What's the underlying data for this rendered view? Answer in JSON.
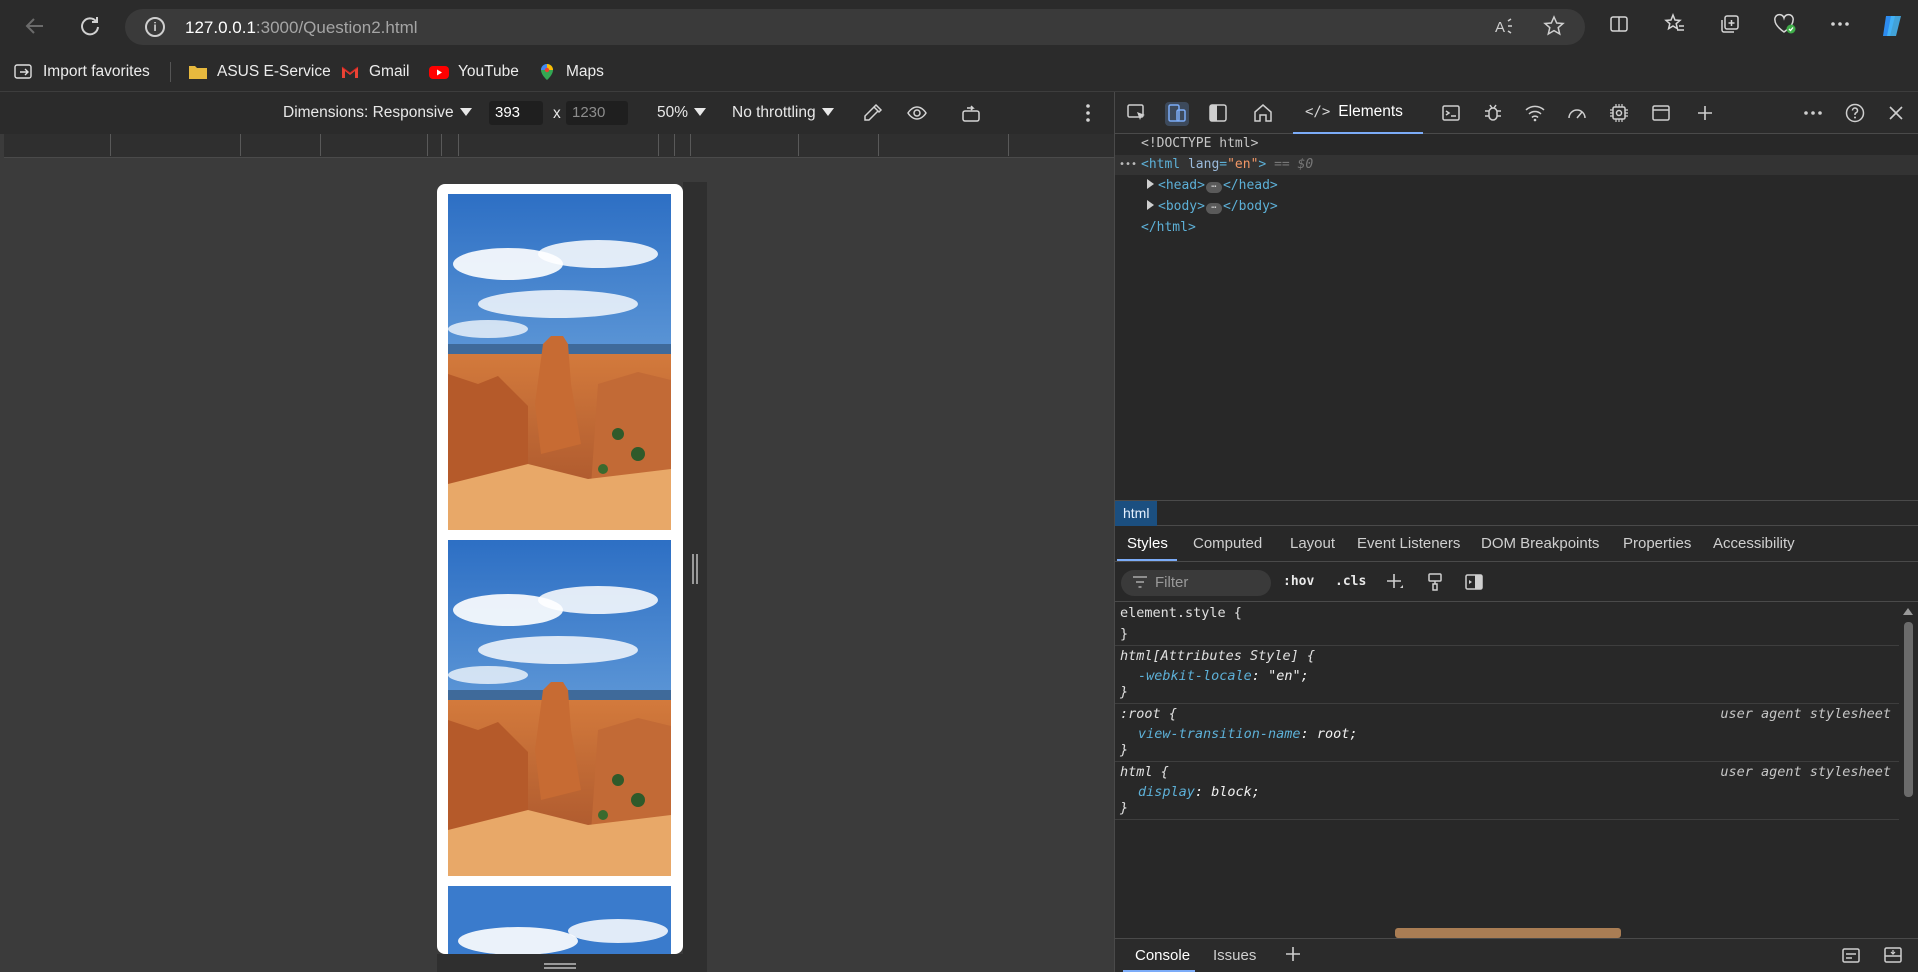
{
  "browser": {
    "url_host": "127.0.0.1",
    "url_path": ":3000/Question2.html",
    "favorites": [
      {
        "label": "Import favorites",
        "icon": "import-icon"
      },
      {
        "label": "ASUS E-Service",
        "icon": "folder-icon"
      },
      {
        "label": "Gmail",
        "icon": "gmail-icon"
      },
      {
        "label": "YouTube",
        "icon": "youtube-icon"
      },
      {
        "label": "Maps",
        "icon": "maps-icon"
      }
    ]
  },
  "device_toolbar": {
    "dimensions_label": "Dimensions: Responsive",
    "width": "393",
    "x_sep": "x",
    "height": "1230",
    "zoom": "50%",
    "throttling": "No throttling"
  },
  "preview": {
    "photo_count": 3,
    "photo_alt": "canyon-hoodoo-photo"
  },
  "devtools": {
    "active_tab": "Elements",
    "dom": {
      "doctype": "<!DOCTYPE html>",
      "html_open_tag": "<html",
      "html_attr_name": "lang",
      "html_attr_value": "\"en\"",
      "html_close_bracket": ">",
      "selected_marker": "== $0",
      "head_open": "<head>",
      "head_close": "</head>",
      "body_open": "<body>",
      "body_close": "</body>",
      "html_close": "</html>",
      "ellipsis": "⋯",
      "row_dots": "•••"
    },
    "breadcrumb": "html",
    "sub_tabs": [
      "Styles",
      "Computed",
      "Layout",
      "Event Listeners",
      "DOM Breakpoints",
      "Properties",
      "Accessibility"
    ],
    "filter_placeholder": "Filter",
    "hov_label": ":hov",
    "cls_label": ".cls",
    "rules": [
      {
        "selector": "element.style {",
        "decls": [],
        "close": "}",
        "source": ""
      },
      {
        "selector": "html[Attributes Style] {",
        "decls": [
          {
            "prop": "-webkit-locale",
            "value": "\"en\";"
          }
        ],
        "close": "}",
        "source": ""
      },
      {
        "selector": ":root {",
        "decls": [
          {
            "prop": "view-transition-name",
            "value": "root;"
          }
        ],
        "close": "}",
        "source": "user agent stylesheet"
      },
      {
        "selector": "html {",
        "decls": [
          {
            "prop": "display",
            "value": "block;"
          }
        ],
        "close": "}",
        "source": "user agent stylesheet"
      }
    ],
    "drawer_tabs": [
      "Console",
      "Issues"
    ]
  },
  "colors": {
    "accent": "#7cacf8",
    "tag": "#5db0d7",
    "attr_value": "#f29766",
    "breadcrumb_bg": "#1b4f80"
  }
}
